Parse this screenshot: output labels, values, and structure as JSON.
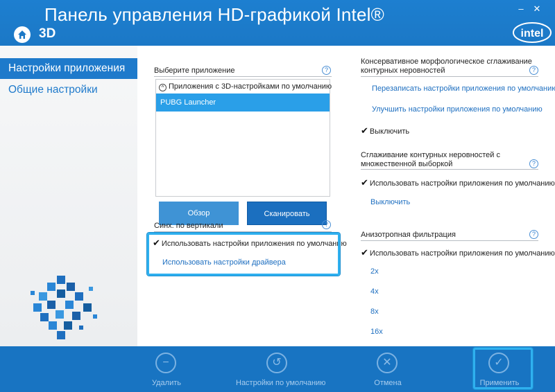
{
  "window": {
    "title": "Панель управления HD-графикой Intel®",
    "section": "3D",
    "minimize": "–",
    "close": "✕",
    "logo": "intel"
  },
  "sidebar": {
    "items": [
      {
        "label": "Настройки приложения",
        "active": true
      },
      {
        "label": "Общие настройки",
        "active": false
      }
    ]
  },
  "app_select": {
    "label": "Выберите приложение",
    "help": "?",
    "group_header": "Приложения с 3D-настройками по умолчанию",
    "group_toggle": "^",
    "items": [
      "PUBG Launcher"
    ],
    "browse_button": "Обзор",
    "scan_button": "Сканировать"
  },
  "vsync": {
    "label": "Синх. по вертикали",
    "help": "?",
    "options": [
      {
        "label": "Использовать настройки приложения по умолчанию",
        "checked": true
      },
      {
        "label": "Использовать настройки драйвера",
        "checked": false
      }
    ]
  },
  "cmaa": {
    "label": "Консервативное морфологическое сглаживание контурных неровностей",
    "help": "?",
    "options": [
      {
        "label": "Перезаписать настройки приложения по умолчанию",
        "checked": false
      },
      {
        "label": "Улучшить настройки приложения по умолчанию",
        "checked": false
      },
      {
        "label": "Выключить",
        "checked": true
      }
    ]
  },
  "msaa": {
    "label": "Сглаживание контурных неровностей с множественной выборкой",
    "help": "?",
    "options": [
      {
        "label": "Использовать настройки приложения по умолчанию",
        "checked": true
      },
      {
        "label": "Выключить",
        "checked": false
      }
    ]
  },
  "aniso": {
    "label": "Анизотропная фильтрация",
    "help": "?",
    "options": [
      {
        "label": "Использовать настройки приложения по умолчанию",
        "checked": true
      },
      {
        "label": "2x",
        "checked": false
      },
      {
        "label": "4x",
        "checked": false
      },
      {
        "label": "8x",
        "checked": false
      },
      {
        "label": "16x",
        "checked": false
      }
    ]
  },
  "toolbar": {
    "delete": "Удалить",
    "defaults": "Настройки по умолчанию",
    "cancel": "Отмена",
    "apply": "Применить"
  },
  "colors": {
    "brand_blue": "#1874c2",
    "highlight": "#2fb0ef",
    "selected_row": "#2a9fe8",
    "link": "#1e6fc0"
  }
}
